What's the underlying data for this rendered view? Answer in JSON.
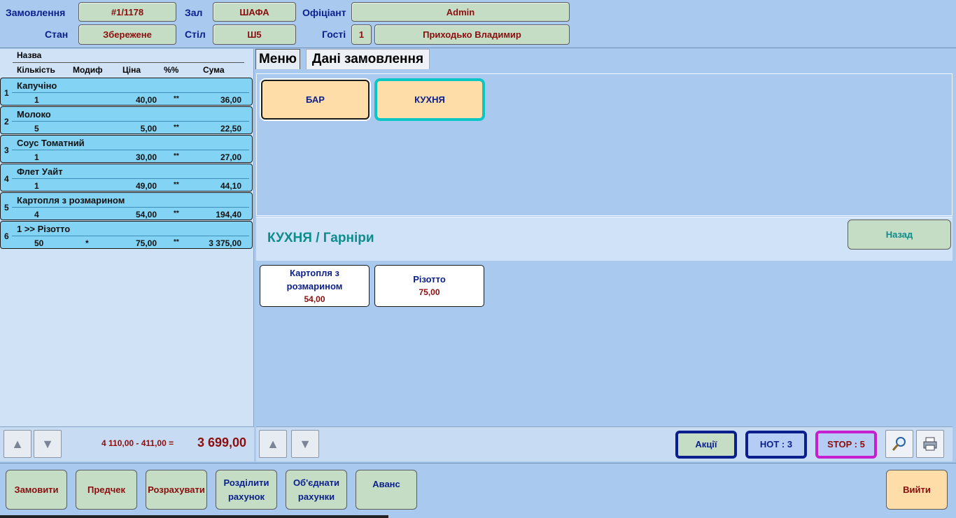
{
  "header": {
    "order_label": "Замовлення",
    "order_value": "#1/1178",
    "hall_label": "Зал",
    "hall_value": "ШАФА",
    "waiter_label": "Офіціант",
    "waiter_value": "Admin",
    "state_label": "Стан",
    "state_value": "Збережене",
    "table_label": "Стіл",
    "table_value": "Ш5",
    "guests_label": "Гості",
    "guests_count": "1",
    "guest_name": "Приходько Владимир"
  },
  "order_list": {
    "col_name": "Назва",
    "col_qty": "Кількість",
    "col_mod": "Модиф",
    "col_price": "Ціна",
    "col_pct": "%%",
    "col_sum": "Сума",
    "rows": [
      {
        "num": "1",
        "name": "Капучіно",
        "qty": "1",
        "mod": "",
        "price": "40,00",
        "pct": "**",
        "sum": "36,00"
      },
      {
        "num": "2",
        "name": "Молоко",
        "qty": "5",
        "mod": "",
        "price": "5,00",
        "pct": "**",
        "sum": "22,50"
      },
      {
        "num": "3",
        "name": "Соус Томатний",
        "qty": "1",
        "mod": "",
        "price": "30,00",
        "pct": "**",
        "sum": "27,00"
      },
      {
        "num": "4",
        "name": "Флет Уайт",
        "qty": "1",
        "mod": "",
        "price": "49,00",
        "pct": "**",
        "sum": "44,10"
      },
      {
        "num": "5",
        "name": "Картопля з розмарином",
        "qty": "4",
        "mod": "",
        "price": "54,00",
        "pct": "**",
        "sum": "194,40"
      },
      {
        "num": "6",
        "name": "1 >> Різотто",
        "qty": "50",
        "mod": "*",
        "price": "75,00",
        "pct": "**",
        "sum": "3 375,00"
      }
    ],
    "subtotal": "4 110,00 - 411,00 =",
    "total": "3 699,00"
  },
  "tabs": [
    {
      "label": "Меню"
    },
    {
      "label": "Дані замовлення"
    }
  ],
  "categories": [
    {
      "label": "БАР"
    },
    {
      "label": "КУХНЯ"
    }
  ],
  "breadcrumb": "КУХНЯ / Гарніри",
  "back_label": "Назад",
  "products": [
    {
      "line1": "Картопля з",
      "line2": "розмарином",
      "price": "54,00"
    },
    {
      "line1": "Різотто",
      "line2": "",
      "price": "75,00"
    }
  ],
  "filters": {
    "promo": "Акції",
    "hot": "HOT : 3",
    "stop": "STOP : 5"
  },
  "actions": {
    "order": "Замовити",
    "precheck": "Предчек",
    "pay": "Розрахувати",
    "split_l1": "Розділити",
    "split_l2": "рахунок",
    "merge_l1": "Об'єднати",
    "merge_l2": "рахунки",
    "advance": "Аванс",
    "exit": "Вийти"
  },
  "colors": {
    "background": "#a9c9ee",
    "field": "#c4ddc4",
    "row": "#83d3f4",
    "category": "#fedda9",
    "accent_text": "#0a1f8c",
    "value_text": "#8b0d0d"
  }
}
